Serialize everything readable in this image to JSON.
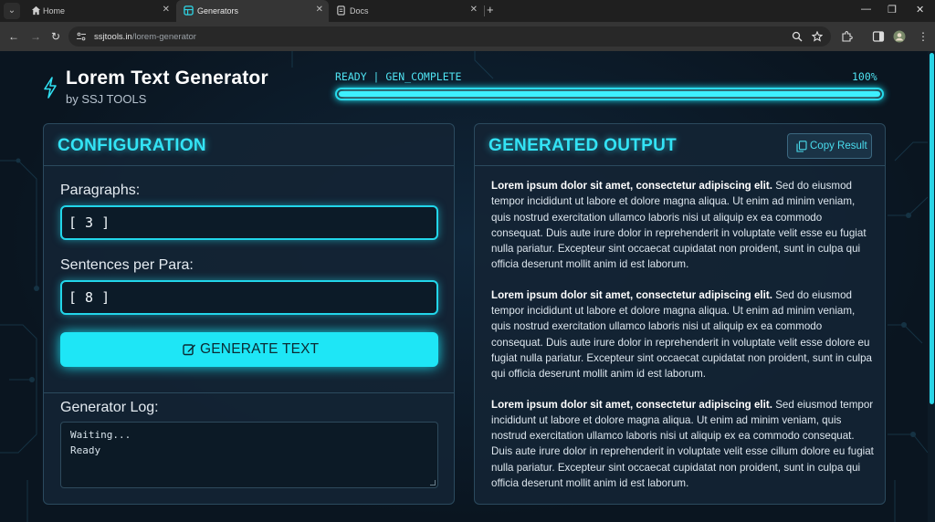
{
  "browser": {
    "tabs": [
      {
        "label": "Home",
        "icon": "home-icon",
        "active": false
      },
      {
        "label": "Generators",
        "icon": "grid-icon",
        "active": true
      },
      {
        "label": "Docs",
        "icon": "document-icon",
        "active": false
      }
    ],
    "url_host": "ssjtools.in",
    "url_path": "/lorem-generator"
  },
  "header": {
    "title": "Lorem Text Generator",
    "subtitle": "by SSJ TOOLS",
    "icon": "bolt-icon"
  },
  "status": {
    "text": "READY | GEN_COMPLETE",
    "percent_label": "100%",
    "progress": 1.0
  },
  "config": {
    "title": "CONFIGURATION",
    "paragraphs_label": "Paragraphs:",
    "paragraphs_value": "[ 3 ]",
    "sentences_label": "Sentences per Para:",
    "sentences_value": "[ 8 ]",
    "generate_label": "GENERATE TEXT",
    "log_label": "Generator Log:",
    "log_lines": [
      "Waiting...",
      "Ready"
    ]
  },
  "output": {
    "title": "GENERATED OUTPUT",
    "copy_label": "Copy Result",
    "paragraphs": [
      {
        "lead": "Lorem ipsum dolor sit amet, consectetur adipiscing elit.",
        "body": "Sed do eiusmod tempor incididunt ut labore et dolore magna aliqua. Ut enim ad minim veniam, quis nostrud exercitation ullamco laboris nisi ut aliquip ex ea commodo consequat. Duis aute irure dolor in reprehenderit in voluptate velit esse eu fugiat nulla pariatur. Excepteur sint occaecat cupidatat non proident, sunt in culpa qui officia deserunt mollit anim id est laborum."
      },
      {
        "lead": "Lorem ipsum dolor sit amet, consectetur adipiscing elit.",
        "body": "Sed do eiusmod tempor incididunt ut labore et dolore magna aliqua. Ut enim ad minim veniam, quis nostrud exercitation ullamco laboris nisi ut aliquip ex ea commodo consequat. Duis aute irure dolor in reprehenderit in voluptate velit esse dolore eu fugiat nulla pariatur. Excepteur sint occaecat cupidatat non proident, sunt in culpa qui officia deserunt mollit anim id est laborum."
      },
      {
        "lead": "Lorem ipsum dolor sit amet, consectetur adipiscing elit.",
        "body": "Sed eiusmod tempor incididunt ut labore et dolore magna aliqua. Ut enim ad minim veniam, quis nostrud exercitation ullamco laboris nisi ut aliquip ex ea commodo consequat. Duis aute irure dolor in reprehenderit in voluptate velit esse cillum dolore eu fugiat nulla pariatur. Excepteur sint occaecat cupidatat non proident, sunt in culpa qui officia deserunt mollit anim id est laborum."
      }
    ]
  },
  "colors": {
    "accent": "#22d6ea",
    "page_bg": "#0b1622",
    "panel_bg": "#142434"
  }
}
